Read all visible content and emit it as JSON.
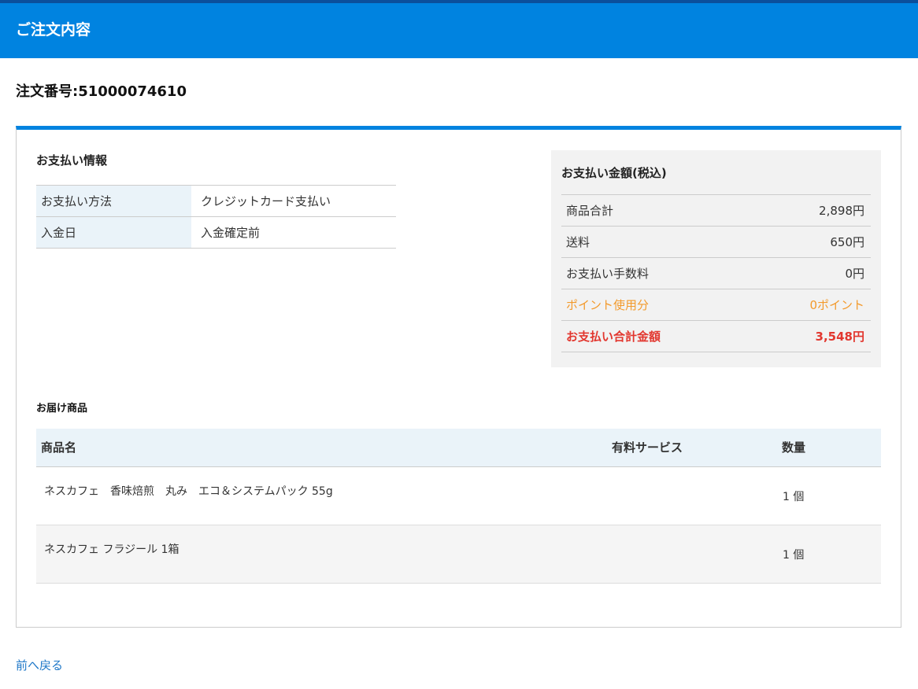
{
  "header": {
    "title": "ご注文内容"
  },
  "order": {
    "number_label": "注文番号:51000074610"
  },
  "payment_info": {
    "title": "お支払い情報",
    "rows": [
      {
        "label": "お支払い方法",
        "value": "クレジットカード支払い"
      },
      {
        "label": "入金日",
        "value": "入金確定前"
      }
    ]
  },
  "amount": {
    "title": "お支払い金額(税込)",
    "rows": [
      {
        "label": "商品合計",
        "value": "2,898円"
      },
      {
        "label": "送料",
        "value": "650円"
      },
      {
        "label": "お支払い手数料",
        "value": "0円"
      },
      {
        "label": "ポイント使用分",
        "value": "0ポイント"
      },
      {
        "label": "お支払い合計金額",
        "value": "3,548円"
      }
    ]
  },
  "delivery": {
    "title": "お届け商品",
    "columns": {
      "name": "商品名",
      "service": "有料サービス",
      "qty": "数量"
    },
    "items": [
      {
        "name": "ネスカフェ　香味焙煎　丸み　エコ＆システムパック 55g",
        "service": "",
        "qty": "1 個"
      },
      {
        "name": "ネスカフェ フラジール 1箱",
        "service": "",
        "qty": "1 個"
      }
    ]
  },
  "back_link": "前へ戻る",
  "colors": {
    "header": "#0083e0",
    "points": "#f39a2c",
    "total": "#e2372f",
    "link": "#1f78c8"
  }
}
